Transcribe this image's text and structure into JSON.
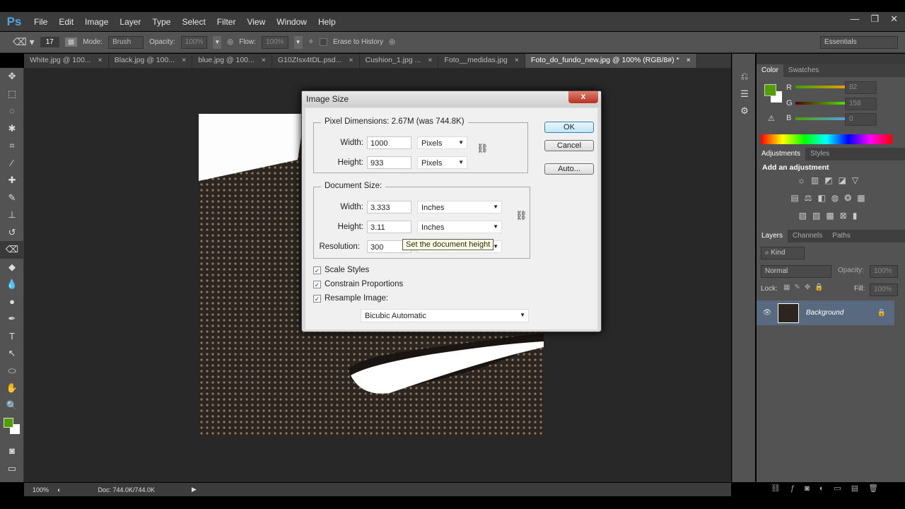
{
  "app": {
    "logo": "Ps",
    "menus": [
      "File",
      "Edit",
      "Image",
      "Layer",
      "Type",
      "Select",
      "Filter",
      "View",
      "Window",
      "Help"
    ],
    "window_controls": [
      "—",
      "❐",
      "✕"
    ]
  },
  "options": {
    "brush_size": "17",
    "mode_label": "Mode:",
    "mode": "Brush",
    "opacity_label": "Opacity:",
    "opacity": "100%",
    "flow_label": "Flow:",
    "flow": "100%",
    "erase_to_history": "Erase to History",
    "erase_to_history_checked": false,
    "workspace": "Essentials"
  },
  "tabs": [
    {
      "label": "White.jpg @ 100..."
    },
    {
      "label": "Black.jpg @ 100..."
    },
    {
      "label": "blue.jpg @ 100..."
    },
    {
      "label": "G10ZIsx4tDL.psd..."
    },
    {
      "label": "Cushion_1.jpg ..."
    },
    {
      "label": "Foto__medidas.jpg"
    },
    {
      "label": "Foto_do_fundo_new.jpg @ 100% (RGB/8#) *",
      "active": true
    }
  ],
  "status": {
    "zoom": "100%",
    "doc": "Doc: 744.0K/744.0K"
  },
  "color_panel": {
    "tabs": [
      "Color",
      "Swatches"
    ],
    "r_label": "R",
    "g_label": "G",
    "b_label": "B",
    "r": "82",
    "g": "158",
    "b": "0",
    "foreground": "#529e00",
    "background": "#ffffff"
  },
  "adjustments": {
    "tabs": [
      "Adjustments",
      "Styles"
    ],
    "heading": "Add an adjustment"
  },
  "layers": {
    "tabs": [
      "Layers",
      "Channels",
      "Paths"
    ],
    "filter": "Kind",
    "blend": "Normal",
    "opacity_label": "Opacity:",
    "opacity": "100%",
    "lock_label": "Lock:",
    "fill_label": "Fill:",
    "fill": "100%",
    "items": [
      {
        "name": "Background",
        "visible": true,
        "locked": true
      }
    ]
  },
  "dialog": {
    "title": "Image Size",
    "close": "x",
    "pixel_dimensions": {
      "legend": "Pixel Dimensions:",
      "size": "2.67M (was 744.8K)",
      "width_label": "Width:",
      "width": "1000",
      "width_unit": "Pixels",
      "height_label": "Height:",
      "height": "933",
      "height_unit": "Pixels"
    },
    "document_size": {
      "legend": "Document Size:",
      "width_label": "Width:",
      "width": "3.333",
      "width_unit": "Inches",
      "height_label": "Height:",
      "height": "3.11",
      "height_unit": "Inches",
      "resolution_label": "Resolution:",
      "resolution": "300"
    },
    "tooltip": "Set the document height",
    "scale_styles": "Scale Styles",
    "constrain": "Constrain Proportions",
    "resample": "Resample Image:",
    "resample_method": "Bicubic Automatic",
    "ok": "OK",
    "cancel": "Cancel",
    "auto": "Auto..."
  }
}
